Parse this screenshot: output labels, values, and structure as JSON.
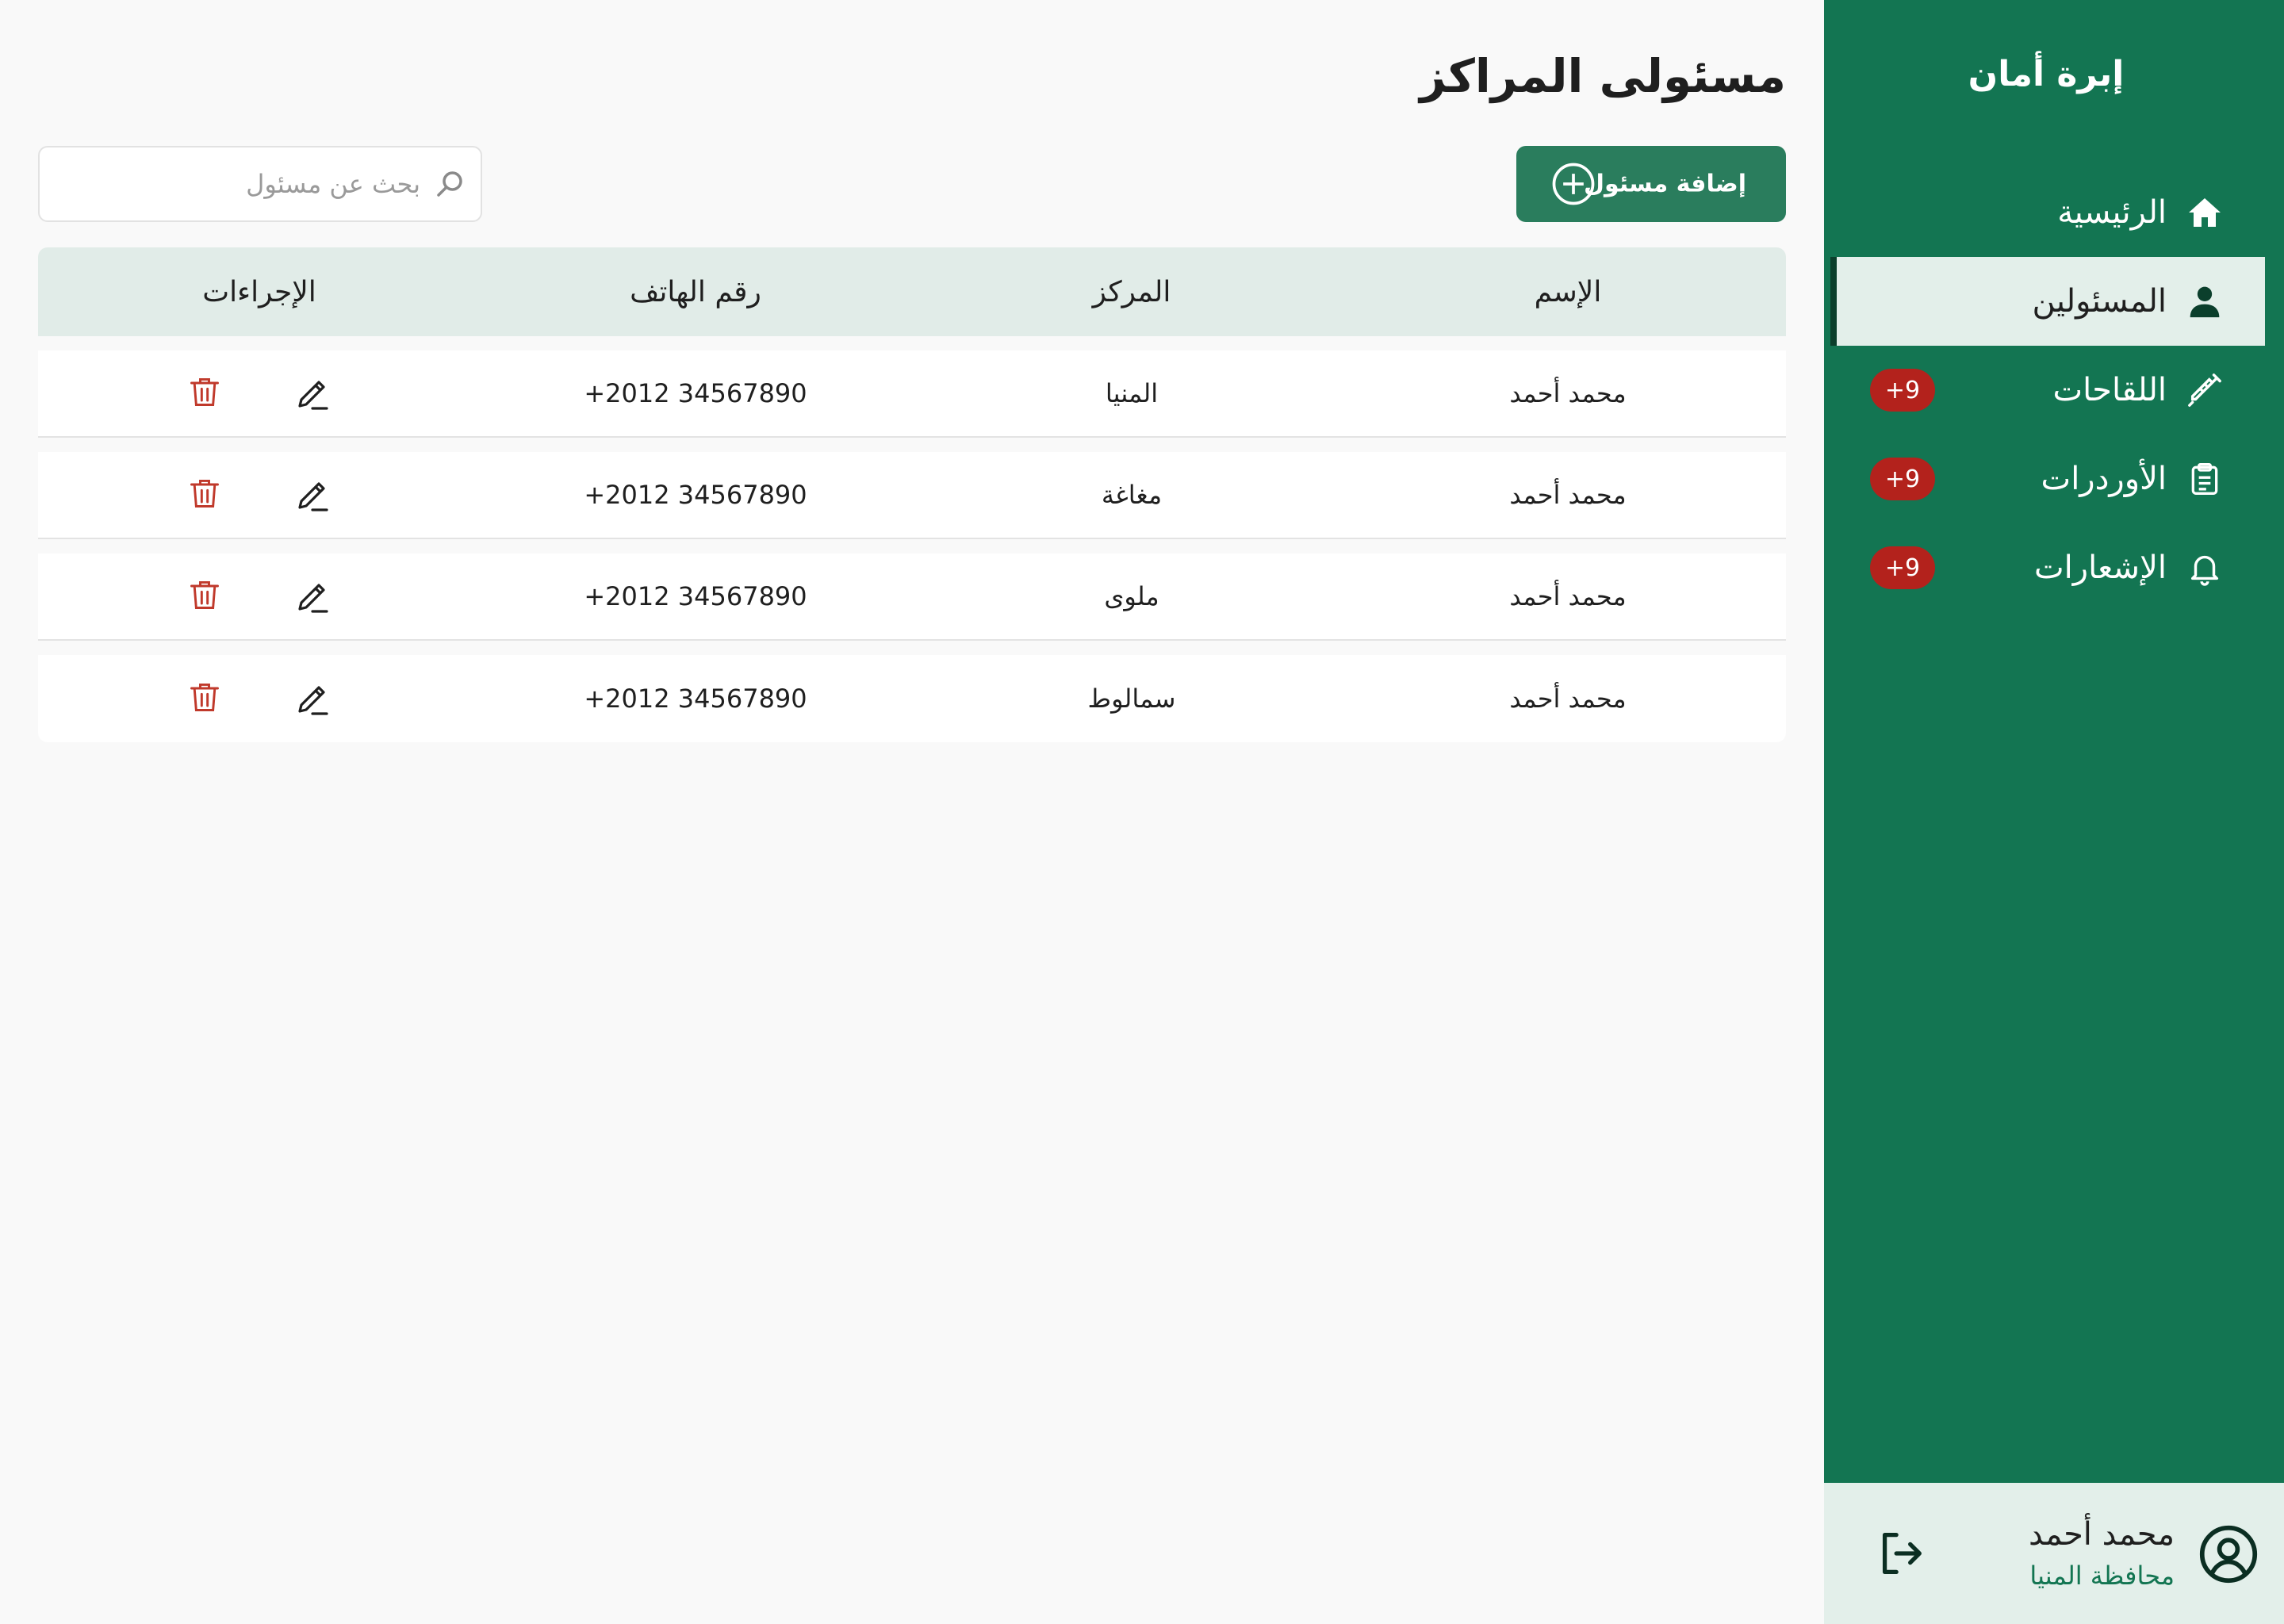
{
  "app": {
    "brand": "إبرة أمان"
  },
  "sidebar": {
    "items": [
      {
        "label": "الرئيسية",
        "icon": "home-icon",
        "active": false,
        "badge": ""
      },
      {
        "label": "المسئولين",
        "icon": "user-icon",
        "active": true,
        "badge": ""
      },
      {
        "label": "اللقاحات",
        "icon": "syringe-icon",
        "active": false,
        "badge": "+9"
      },
      {
        "label": "الأوردرات",
        "icon": "clipboard-icon",
        "active": false,
        "badge": "+9"
      },
      {
        "label": "الإشعارات",
        "icon": "bell-icon",
        "active": false,
        "badge": "+9"
      }
    ],
    "user": {
      "name": "محمد أحمد",
      "region": "محافظة المنيا"
    }
  },
  "main": {
    "title": "مسئولى المراكز",
    "add_button_label": "إضافة مسئول",
    "search_placeholder": "بحث عن مسئول",
    "search_value": "",
    "table": {
      "headers": {
        "name": "الإسم",
        "center": "المركز",
        "phone": "رقم الهاتف",
        "actions": "الإجراءات"
      },
      "rows": [
        {
          "name": "محمد أحمد",
          "center": "المنيا",
          "phone": "+2012 34567890"
        },
        {
          "name": "محمد أحمد",
          "center": "مغاغة",
          "phone": "+2012 34567890"
        },
        {
          "name": "محمد أحمد",
          "center": "ملوى",
          "phone": "+2012 34567890"
        },
        {
          "name": "محمد أحمد",
          "center": "سمالوط",
          "phone": "+2012 34567890"
        }
      ]
    }
  },
  "colors": {
    "sidebar_bg": "#137552",
    "active_bg": "#e3efea",
    "badge_bg": "#b3221c",
    "button_bg": "#2a7d5d",
    "table_header_bg": "#e1ece8",
    "delete_icon": "#c0392b"
  }
}
